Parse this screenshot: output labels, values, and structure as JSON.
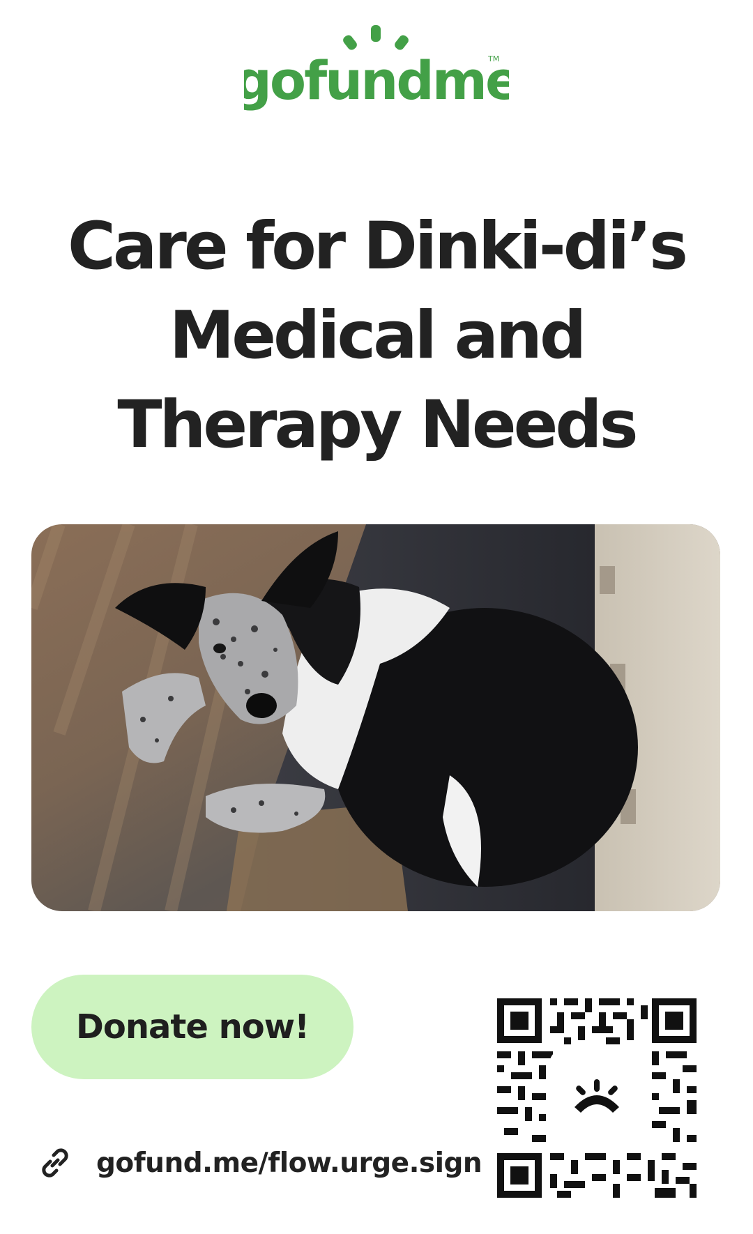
{
  "brand": {
    "logo_text": "gofundme",
    "trademark": "TM",
    "color": "#43a047"
  },
  "campaign": {
    "title_lines": [
      "Care for Dinki-di’s",
      "Medical and",
      "Therapy Needs"
    ]
  },
  "photo": {
    "icon": "dog-photo"
  },
  "actions": {
    "donate_label": "Donate now!",
    "donate_color": "#cdf3c0"
  },
  "share": {
    "url": "gofund.me/flow.urge.sign",
    "icon": "link-icon"
  },
  "qr": {
    "icon": "gofundme-sun-icon"
  }
}
